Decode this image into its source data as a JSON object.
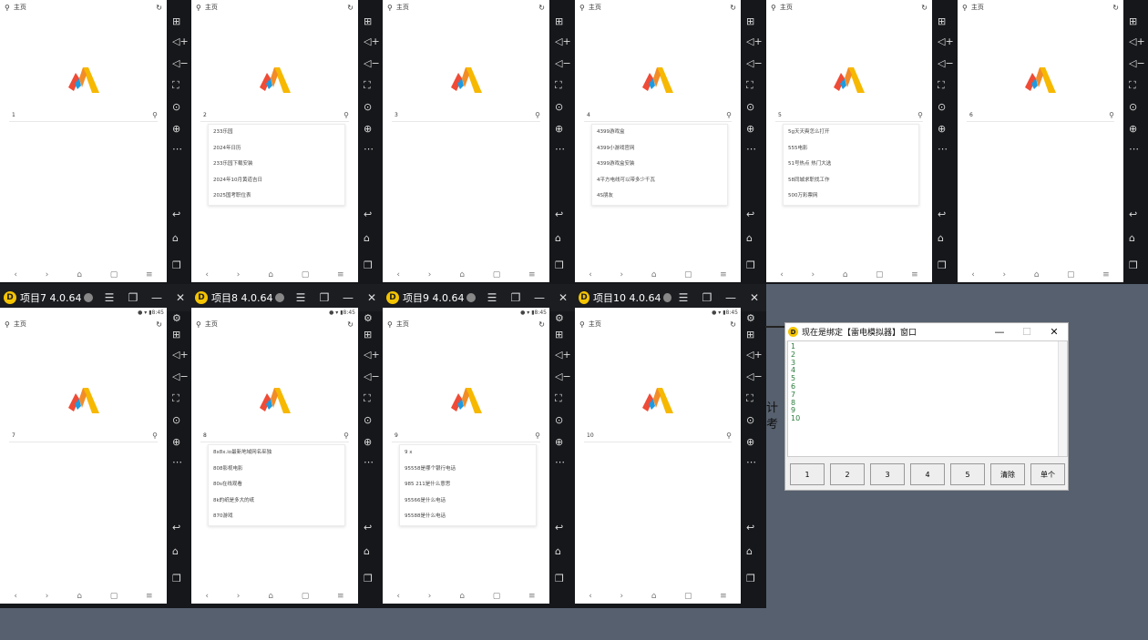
{
  "tabs": [
    {
      "title": "",
      "searchText": "1",
      "sugg": []
    },
    {
      "title": "",
      "searchText": "2",
      "sugg": [
        "233乐园",
        "2024年日历",
        "233乐园下载安装",
        "2024年10月黄道吉日",
        "2025国考职位表"
      ]
    },
    {
      "title": "",
      "searchText": "3",
      "sugg": []
    },
    {
      "title": "",
      "searchText": "4",
      "sugg": [
        "4399游戏盒",
        "4399小游戏官网",
        "4399游戏盒安装",
        "4平方电线可以带多少千瓦",
        "4S朋友"
      ]
    },
    {
      "title": "",
      "searchText": "5",
      "sugg": [
        "5g天天奭怎么打开",
        "555电影",
        "51号热点 热门大选",
        "58同城求职找工作",
        "500万彩票网"
      ]
    },
    {
      "title": "",
      "searchText": "6",
      "sugg": []
    },
    {
      "title": "项目7 4.0.64",
      "searchText": "7",
      "sugg": []
    },
    {
      "title": "项目8 4.0.64",
      "searchText": "8",
      "sugg": [
        "8x8x.io最新地域网名巫独",
        "808影视电影",
        "80s在线观看",
        "8k的纸是多大的纸",
        "870游戏"
      ]
    },
    {
      "title": "项目9 4.0.64",
      "searchText": "9",
      "sugg": [
        "9 x",
        "95558是哪个银行电话",
        "985 211是什么意思",
        "95566是什么电话",
        "95588是什么电话"
      ]
    },
    {
      "title": "项目10 4.0.64",
      "searchText": "10",
      "sugg": []
    }
  ],
  "common": {
    "homeLabel": "主页",
    "statusTime": "8:45"
  },
  "window": {
    "title": "现在是绑定【雷电模拟器】窗口",
    "lines": [
      "1",
      "2",
      "3",
      "4",
      "5",
      "6",
      "7",
      "8",
      "9",
      "10"
    ],
    "buttons": [
      "1",
      "2",
      "3",
      "4",
      "5",
      "清除",
      "单个"
    ]
  },
  "sideLabel": "计考"
}
